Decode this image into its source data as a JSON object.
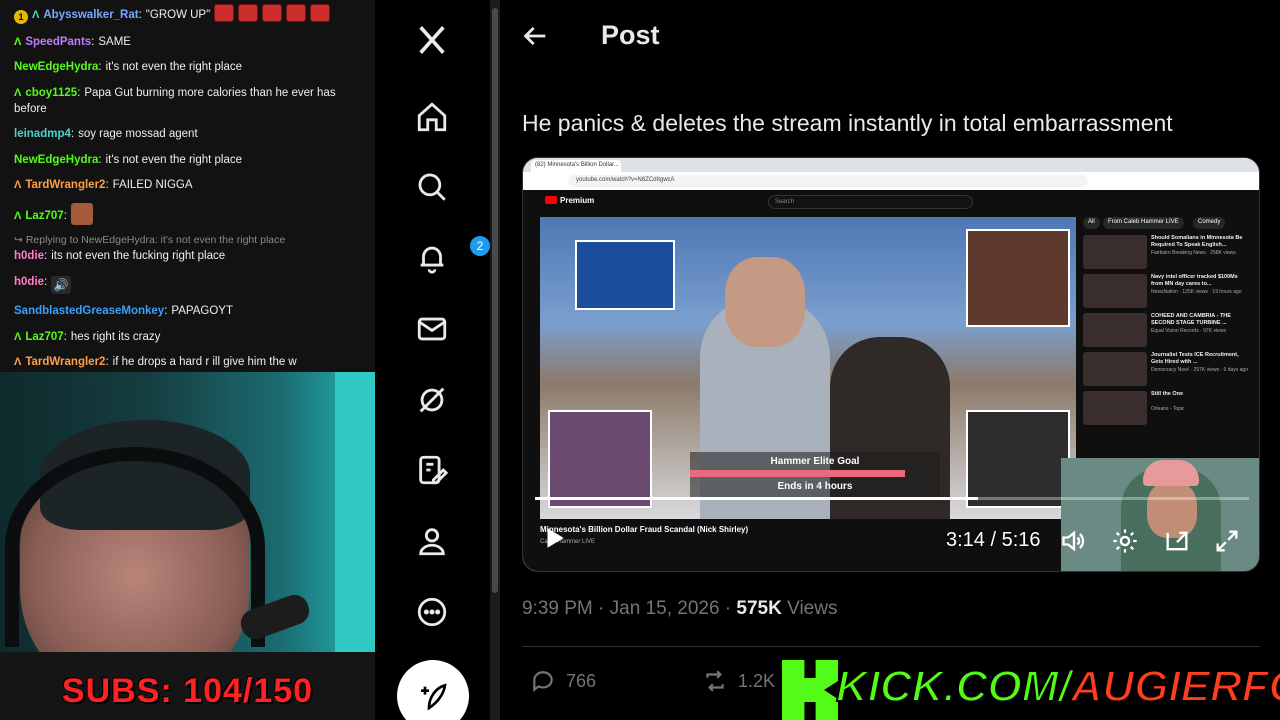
{
  "chat": {
    "messages": [
      {
        "badge": "1",
        "user": "Abysswalker_Rat",
        "user_color": "#7aa7ff",
        "text": "\"GROW UP\"",
        "emotes": 5
      },
      {
        "badge": "A",
        "user": "SpeedPants",
        "user_color": "#c07cff",
        "text": "SAME"
      },
      {
        "badge": "",
        "user": "NewEdgeHydra",
        "user_color": "#53fc18",
        "text": "it's not even the right place"
      },
      {
        "badge": "A",
        "user": "cboy1125",
        "user_color": "#53fc18",
        "text": "Papa Gut burning more calories than he ever has before"
      },
      {
        "badge": "",
        "user": "leinadmp4",
        "user_color": "#4fd2c8",
        "text": "soy rage mossad agent"
      },
      {
        "badge": "",
        "user": "NewEdgeHydra",
        "user_color": "#53fc18",
        "text": "it's not even the right place"
      },
      {
        "badge": "A",
        "user": "TardWrangler2",
        "user_color": "#ff9f4a",
        "text": "FAILED NIGGA"
      },
      {
        "badge": "A",
        "user": "Laz707",
        "user_color": "#53fc18",
        "text": ""
      },
      {
        "reply": "Replying to NewEdgeHydra: it's not even the right place",
        "badge": "",
        "user": "h0die",
        "user_color": "#ff7fc6",
        "text": "its not even the fucking right place"
      },
      {
        "badge": "",
        "user": "h0die",
        "user_color": "#ff7fc6",
        "text": ""
      },
      {
        "badge": "",
        "user": "SandblastedGreaseMonkey",
        "user_color": "#3aa0ff",
        "text": "PAPAGOYT"
      },
      {
        "badge": "A",
        "user": "Laz707",
        "user_color": "#53fc18",
        "text": "hes right its crazy"
      },
      {
        "badge": "A",
        "user": "TardWrangler2",
        "user_color": "#ff9f4a",
        "text": "if he drops a hard r ill give him the w"
      }
    ]
  },
  "webcam": {
    "subs_label": "SUBS: 104/150"
  },
  "nav": {
    "notification_count": "2"
  },
  "post": {
    "header_title": "Post",
    "text": "He panics & deletes the stream instantly in total embarrassment",
    "timestamp": "9:39 PM · Jan 15, 2026",
    "views_count": "575K",
    "views_label": "Views",
    "reply_count": "766",
    "repost_count": "1.2K"
  },
  "video": {
    "browser_tab": "(82) Minnesota's Billion Dollar...",
    "url": "youtube.com/watch?v=N8ZCdItgwcA",
    "search_placeholder": "Search",
    "premium_label": "Premium",
    "goal_label": "Hammer Elite Goal",
    "goal_ends": "Ends in 4 hours",
    "goal_progress": 0.86,
    "title": "Minnesota's Billion Dollar Fraud Scandal (Nick Shirley)",
    "channel": "Caleb Hammer LIVE",
    "chips": [
      "All",
      "From Caleb Hammer LIVE",
      "Comedy"
    ],
    "recommendations": [
      {
        "title": "Should Somalians in Minnesota Be Required To Speak English...",
        "meta": "Fairbairn Breaking News · 258K views"
      },
      {
        "title": "Navy intel officer tracked $100Ms from MN day cares to...",
        "meta": "NewsNation · 125K views · 19 hours ago"
      },
      {
        "title": "COHEED AND CAMBRIA - THE SECOND STAGE TURBINE ...",
        "meta": "Equal Vision Records · 97K views"
      },
      {
        "title": "Journalist Tests ICE Recruitment, Gets Hired with ...",
        "meta": "Democracy Now! · 297K views · 9 days ago"
      },
      {
        "title": "Still the One",
        "meta": "Orleans - Topic"
      }
    ],
    "time_readout": "3:14 / 5:16",
    "played_fraction": 0.62
  },
  "overlay": {
    "kick_prefix": "KICK.COM/",
    "kick_name": "AUGIERFC"
  },
  "colors": {
    "x_blue": "#1d9bf0",
    "kick_green": "#53fc18",
    "subs_red": "#ff2222"
  }
}
